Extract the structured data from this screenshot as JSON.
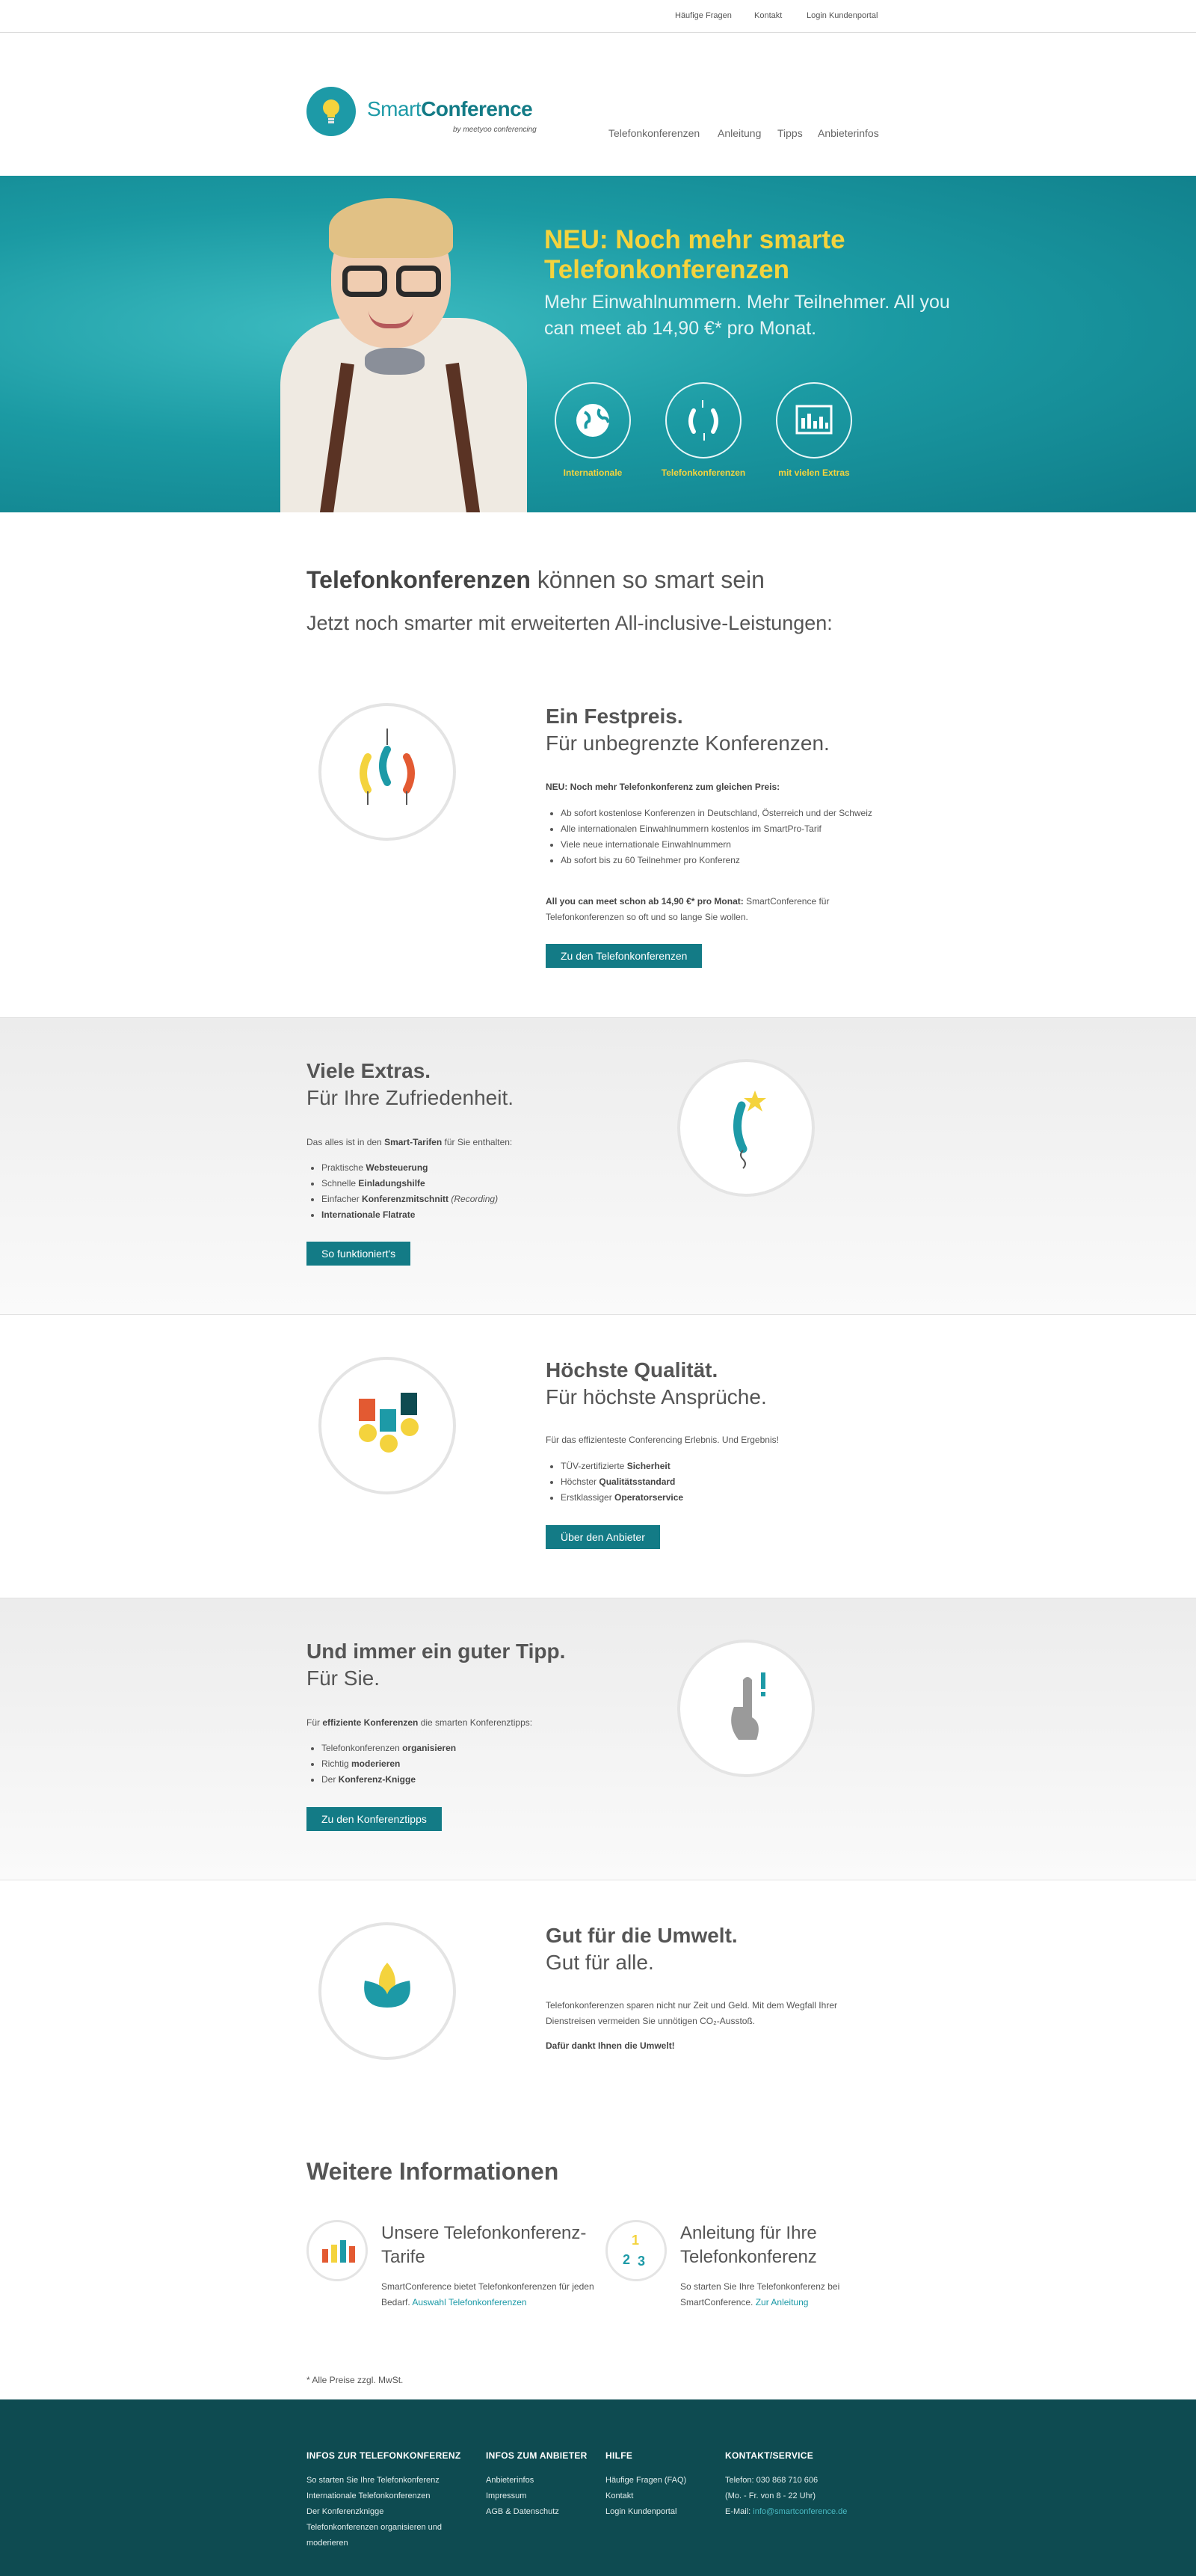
{
  "topbar": {
    "faq": "Häufige Fragen",
    "contact": "Kontakt",
    "login": "Login Kundenportal"
  },
  "logo": {
    "smart": "Smart",
    "conference": "Conference",
    "sub": "by meetyoo conferencing"
  },
  "nav": {
    "items": [
      "Telefonkonferenzen",
      "Anleitung",
      "Tipps",
      "Anbieterinfos"
    ]
  },
  "hero": {
    "title": "NEU: Noch mehr smarte Telefonkonferenzen",
    "subtitle": "Mehr Einwahlnummern. Mehr Teilnehmer. All you can meet ab 14,90 €* pro Monat.",
    "icons": [
      {
        "icon": "globe-icon",
        "label": "Internationale"
      },
      {
        "icon": "phones-icon",
        "label": "Telefonkonferenzen"
      },
      {
        "icon": "chart-screen-icon",
        "label": "mit vielen Extras"
      }
    ]
  },
  "intro": {
    "heading_bold": "Telefonkonferenzen",
    "heading_rest": " können so smart sein",
    "subheading": "Jetzt noch smarter mit erweiterten All-inclusive-Leistungen:"
  },
  "festpreis": {
    "title": "Ein Festpreis.",
    "subtitle": "Für unbegrenzte Konferenzen.",
    "lead": "NEU: Noch mehr Telefonkonferenz zum gleichen Preis:",
    "bullets": [
      "Ab sofort kostenlose Konferenzen in Deutschland, Österreich und der Schweiz",
      "Alle internationalen Einwahlnummern kostenlos im SmartPro-Tarif",
      "Viele neue internationale Einwahlnummern",
      "Ab sofort bis zu 60 Teilnehmer pro Konferenz"
    ],
    "closing_bold": "All you can meet schon ab 14,90 €* pro Monat:",
    "closing_rest": " SmartConference für Telefonkonferenzen so oft und so lange Sie wollen.",
    "button": "Zu den Telefonkonferenzen"
  },
  "extras": {
    "title": "Viele Extras.",
    "subtitle": "Für Ihre Zufriedenheit.",
    "lead_pre": "Das alles ist in den ",
    "lead_bold": "Smart-Tarifen",
    "lead_post": " für Sie enthalten:",
    "bullets": [
      {
        "pre": "Praktische ",
        "bold": "Websteuerung",
        "post": ""
      },
      {
        "pre": "Schnelle ",
        "bold": "Einladungshilfe",
        "post": ""
      },
      {
        "pre": "Einfacher ",
        "bold": "Konferenzmitschnitt",
        "post": " (Recording)"
      },
      {
        "pre": "",
        "bold": "Internationale Flatrate",
        "post": ""
      }
    ],
    "button": "So funktioniert's"
  },
  "qualitaet": {
    "title": "Höchste Qualität.",
    "subtitle": "Für höchste Ansprüche.",
    "lead": "Für das effizienteste Conferencing Erlebnis. Und Ergebnis!",
    "bullets": [
      {
        "pre": "TÜV-zertifizierte ",
        "bold": "Sicherheit"
      },
      {
        "pre": "Höchster ",
        "bold": "Qualitätsstandard"
      },
      {
        "pre": "Erstklassiger ",
        "bold": "Operatorservice"
      }
    ],
    "button": "Über den Anbieter"
  },
  "tipp": {
    "title": "Und immer ein guter Tipp.",
    "subtitle": "Für Sie.",
    "lead_pre": "Für ",
    "lead_bold": "effiziente Konferenzen",
    "lead_post": " die smarten Konferenztipps:",
    "bullets": [
      {
        "pre": "Telefonkonferenzen ",
        "bold": "organisieren"
      },
      {
        "pre": "Richtig ",
        "bold": "moderieren"
      },
      {
        "pre": "Der ",
        "bold": "Konferenz-Knigge"
      }
    ],
    "button": "Zu den Konferenztipps"
  },
  "umwelt": {
    "title": "Gut für die Umwelt.",
    "subtitle": "Gut für alle.",
    "text": "Telefonkonferenzen sparen nicht nur Zeit und Geld. Mit dem Wegfall Ihrer Dienstreisen vermeiden Sie unnötigen CO₂-Ausstoß.",
    "closing": "Dafür dankt Ihnen die Umwelt!"
  },
  "weitere": {
    "heading": "Weitere Informationen",
    "tarife": {
      "title": "Unsere Telefonkonferenz-Tarife",
      "text": "SmartConference bietet Telefonkonferenzen für jeden Bedarf. ",
      "link": "Auswahl Telefonkonferenzen"
    },
    "anleitung": {
      "title": "Anleitung für Ihre Telefonkonferenz",
      "text": "So starten Sie Ihre Telefonkonferenz bei SmartConference. ",
      "link": "Zur Anleitung"
    }
  },
  "footnote": "* Alle Preise zzgl. MwSt.",
  "footer": {
    "col1": {
      "heading": "INFOS ZUR TELEFONKONFERENZ",
      "items": [
        "So starten Sie Ihre Telefonkonferenz",
        "Internationale Telefonkonferenzen",
        "Der Konferenzknigge",
        "Telefonkonferenzen organisieren und moderieren"
      ]
    },
    "col2": {
      "heading": "INFOS ZUM ANBIETER",
      "items": [
        "Anbieterinfos",
        "Impressum",
        "AGB & Datenschutz"
      ]
    },
    "col3": {
      "heading": "HILFE",
      "items": [
        "Häufige Fragen (FAQ)",
        "Kontakt",
        "Login Kundenportal"
      ]
    },
    "col4": {
      "heading": "KONTAKT/SERVICE",
      "phone": "Telefon: 030 868 710 606",
      "hours": "(Mo. - Fr. von 8 - 22 Uhr)",
      "email_label": "E-Mail: ",
      "email": "info@smartconference.de"
    }
  },
  "colors": {
    "teal": "#1d9aa7",
    "dark_teal": "#137b86",
    "yellow": "#f4d33d",
    "footer": "#0e4b51"
  }
}
